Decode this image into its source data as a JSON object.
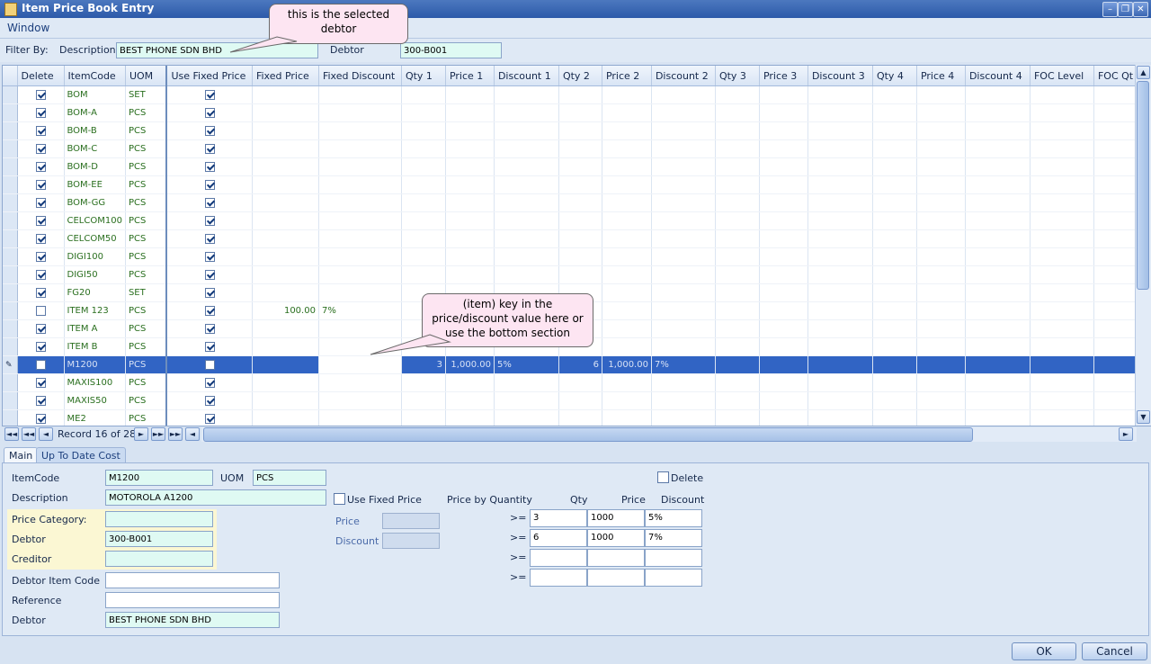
{
  "window": {
    "title": "Item Price Book Entry"
  },
  "menu": {
    "window": "Window"
  },
  "filter": {
    "label": "Filter By:",
    "description_label": "Description",
    "description_value": "BEST PHONE SDN BHD",
    "debtor_label": "Debtor",
    "debtor_value": "300-B001"
  },
  "callouts": {
    "debtor": "this is the selected debtor",
    "item": "(item) key in the price/discount value here or use the bottom section"
  },
  "grid": {
    "columns": [
      "Delete",
      "ItemCode",
      "UOM",
      "Use Fixed Price",
      "Fixed Price",
      "Fixed Discount",
      "Qty 1",
      "Price 1",
      "Discount 1",
      "Qty 2",
      "Price 2",
      "Discount 2",
      "Qty 3",
      "Price 3",
      "Discount 3",
      "Qty 4",
      "Price 4",
      "Discount 4",
      "FOC Level",
      "FOC Qt"
    ],
    "rows": [
      {
        "delete": true,
        "code": "BOM",
        "uom": "SET",
        "fixed": true
      },
      {
        "delete": true,
        "code": "BOM-A",
        "uom": "PCS",
        "fixed": true
      },
      {
        "delete": true,
        "code": "BOM-B",
        "uom": "PCS",
        "fixed": true
      },
      {
        "delete": true,
        "code": "BOM-C",
        "uom": "PCS",
        "fixed": true
      },
      {
        "delete": true,
        "code": "BOM-D",
        "uom": "PCS",
        "fixed": true
      },
      {
        "delete": true,
        "code": "BOM-EE",
        "uom": "PCS",
        "fixed": true
      },
      {
        "delete": true,
        "code": "BOM-GG",
        "uom": "PCS",
        "fixed": true
      },
      {
        "delete": true,
        "code": "CELCOM100",
        "uom": "PCS",
        "fixed": true
      },
      {
        "delete": true,
        "code": "CELCOM50",
        "uom": "PCS",
        "fixed": true
      },
      {
        "delete": true,
        "code": "DIGI100",
        "uom": "PCS",
        "fixed": true
      },
      {
        "delete": true,
        "code": "DIGI50",
        "uom": "PCS",
        "fixed": true
      },
      {
        "delete": true,
        "code": "FG20",
        "uom": "SET",
        "fixed": true
      },
      {
        "delete": false,
        "code": "ITEM 123",
        "uom": "PCS",
        "fixed": true,
        "fixed_price": "100.00",
        "fixed_discount": "7%"
      },
      {
        "delete": true,
        "code": "ITEM A",
        "uom": "PCS",
        "fixed": true
      },
      {
        "delete": true,
        "code": "ITEM B",
        "uom": "PCS",
        "fixed": true
      },
      {
        "delete": false,
        "code": "M1200",
        "uom": "PCS",
        "fixed": false,
        "selected": true,
        "qty1": "3",
        "price1": "1,000.00",
        "disc1": "5%",
        "qty2": "6",
        "price2": "1,000.00",
        "disc2": "7%"
      },
      {
        "delete": true,
        "code": "MAXIS100",
        "uom": "PCS",
        "fixed": true
      },
      {
        "delete": true,
        "code": "MAXIS50",
        "uom": "PCS",
        "fixed": true
      },
      {
        "delete": true,
        "code": "ME2",
        "uom": "PCS",
        "fixed": true
      }
    ]
  },
  "navigator": {
    "record": "Record 16 of 28"
  },
  "tabs": {
    "main": "Main",
    "cost": "Up To Date Cost"
  },
  "form": {
    "itemcode_label": "ItemCode",
    "itemcode": "M1200",
    "uom_label": "UOM",
    "uom": "PCS",
    "description_label": "Description",
    "description": "MOTOROLA A1200",
    "price_category_label": "Price Category:",
    "price_category": "",
    "debtor_label": "Debtor",
    "debtor": "300-B001",
    "creditor_label": "Creditor",
    "creditor": "",
    "debtor_item_code_label": "Debtor Item Code",
    "debtor_item_code": "",
    "reference_label": "Reference",
    "reference": "",
    "debtor_name_label": "Debtor",
    "debtor_name": "BEST PHONE SDN BHD",
    "use_fixed_price_label": "Use Fixed Price",
    "price_label": "Price",
    "discount_label": "Discount",
    "delete_label": "Delete",
    "pbq": {
      "title": "Price by Quantity",
      "qty_label": "Qty",
      "price_label": "Price",
      "discount_label": "Discount",
      "op": ">=",
      "rows": [
        {
          "qty": "3",
          "price": "1000",
          "disc": "5%"
        },
        {
          "qty": "6",
          "price": "1000",
          "disc": "7%"
        },
        {
          "qty": "",
          "price": "",
          "disc": ""
        },
        {
          "qty": "",
          "price": "",
          "disc": ""
        }
      ]
    }
  },
  "buttons": {
    "ok": "OK",
    "cancel": "Cancel"
  }
}
